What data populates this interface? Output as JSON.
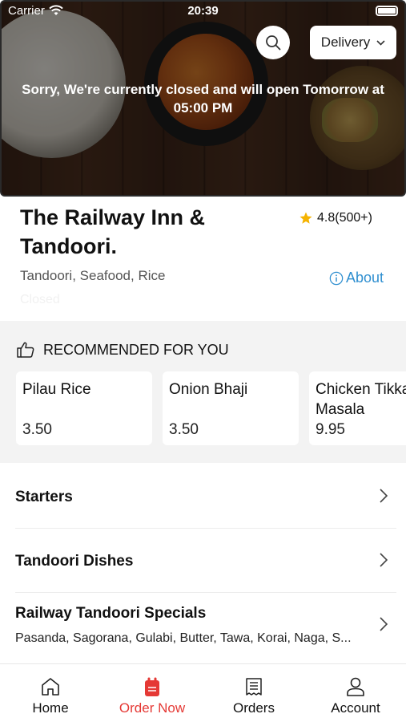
{
  "status_bar": {
    "carrier": "Carrier",
    "time": "20:39"
  },
  "hero": {
    "delivery_label": "Delivery",
    "closed_message": "Sorry, We're currently closed and will open Tomorrow at 05:00 PM"
  },
  "restaurant": {
    "name": "The Railway Inn & Tandoori.",
    "rating": "4.8(500+)",
    "cuisines": "Tandoori, Seafood, Rice",
    "about_label": "About",
    "status_faded": "Closed"
  },
  "recommended": {
    "title": "RECOMMENDED FOR YOU",
    "items": [
      {
        "name": "Pilau Rice",
        "price": "3.50"
      },
      {
        "name": "Onion Bhaji",
        "price": "3.50"
      },
      {
        "name": "Chicken Tikka",
        "name2": "Masala",
        "price": "9.95"
      }
    ]
  },
  "categories": [
    {
      "title": "Starters"
    },
    {
      "title": "Tandoori Dishes"
    },
    {
      "title": "Railway Tandoori Specials",
      "subtitle": "Pasanda, Sagorana, Gulabi, Butter, Tawa, Korai, Naga, S..."
    }
  ],
  "tabs": [
    {
      "label": "Home",
      "icon": "home-icon"
    },
    {
      "label": "Order Now",
      "icon": "order-bag-icon",
      "active": true
    },
    {
      "label": "Orders",
      "icon": "receipt-icon"
    },
    {
      "label": "Account",
      "icon": "person-icon"
    }
  ],
  "colors": {
    "accent": "#e53935",
    "link": "#2f8fd0",
    "star": "#f5b301"
  }
}
